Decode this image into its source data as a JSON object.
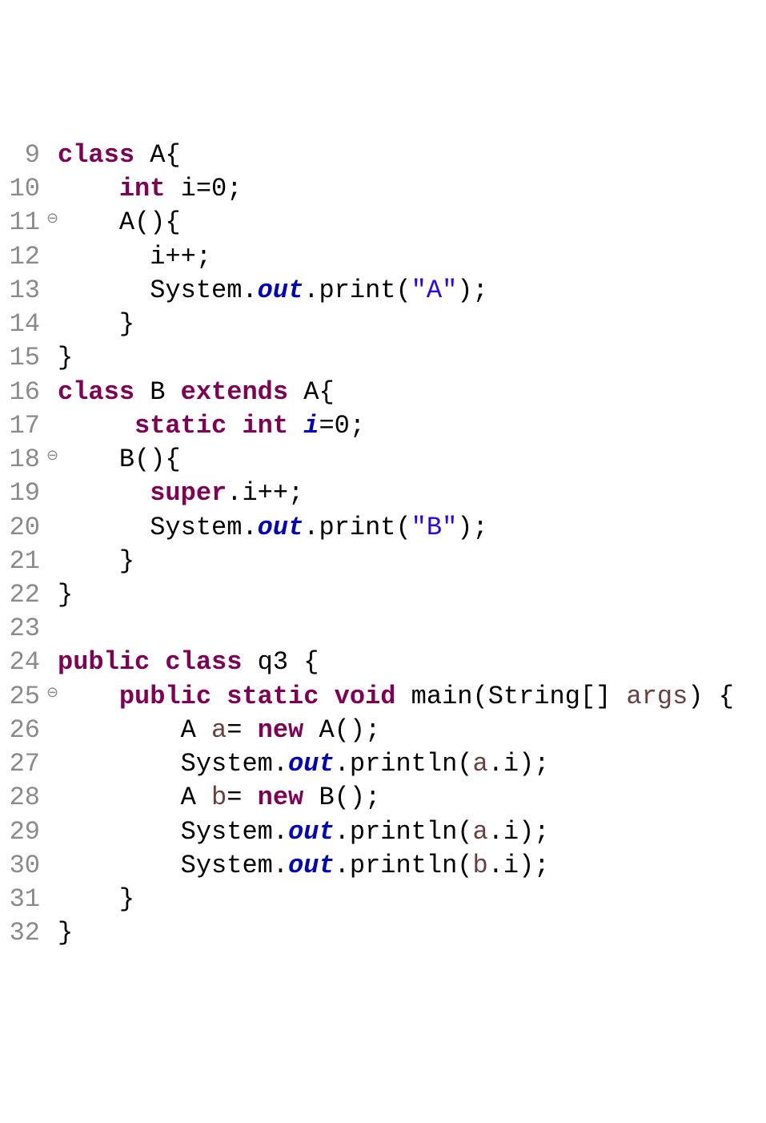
{
  "lines": [
    {
      "num": "9",
      "marker": "",
      "tokens": [
        {
          "t": "class ",
          "c": "kw"
        },
        {
          "t": "A{",
          "c": "plain"
        }
      ]
    },
    {
      "num": "10",
      "marker": "",
      "tokens": [
        {
          "t": "    ",
          "c": "plain"
        },
        {
          "t": "int ",
          "c": "kw"
        },
        {
          "t": "i",
          "c": "plain"
        },
        {
          "t": "=0;",
          "c": "plain"
        }
      ]
    },
    {
      "num": "11",
      "marker": "⊖",
      "tokens": [
        {
          "t": "    A(){",
          "c": "plain"
        }
      ]
    },
    {
      "num": "12",
      "marker": "",
      "tokens": [
        {
          "t": "      i++;",
          "c": "plain"
        }
      ]
    },
    {
      "num": "13",
      "marker": "",
      "tokens": [
        {
          "t": "      System.",
          "c": "plain"
        },
        {
          "t": "out",
          "c": "fld"
        },
        {
          "t": ".print(",
          "c": "plain"
        },
        {
          "t": "\"A\"",
          "c": "str"
        },
        {
          "t": ");",
          "c": "plain"
        }
      ]
    },
    {
      "num": "14",
      "marker": "",
      "tokens": [
        {
          "t": "    }",
          "c": "plain"
        }
      ]
    },
    {
      "num": "15",
      "marker": "",
      "tokens": [
        {
          "t": "}",
          "c": "plain"
        }
      ]
    },
    {
      "num": "16",
      "marker": "",
      "tokens": [
        {
          "t": "class ",
          "c": "kw"
        },
        {
          "t": "B ",
          "c": "plain"
        },
        {
          "t": "extends ",
          "c": "kw"
        },
        {
          "t": "A{",
          "c": "plain"
        }
      ]
    },
    {
      "num": "17",
      "marker": "",
      "tokens": [
        {
          "t": "     ",
          "c": "plain"
        },
        {
          "t": "static int ",
          "c": "kw"
        },
        {
          "t": "i",
          "c": "fld"
        },
        {
          "t": "=0;",
          "c": "plain"
        }
      ]
    },
    {
      "num": "18",
      "marker": "⊖",
      "tokens": [
        {
          "t": "    B(){",
          "c": "plain"
        }
      ]
    },
    {
      "num": "19",
      "marker": "",
      "tokens": [
        {
          "t": "      ",
          "c": "plain"
        },
        {
          "t": "super",
          "c": "kw"
        },
        {
          "t": ".i++;",
          "c": "plain"
        }
      ]
    },
    {
      "num": "20",
      "marker": "",
      "tokens": [
        {
          "t": "      System.",
          "c": "plain"
        },
        {
          "t": "out",
          "c": "fld"
        },
        {
          "t": ".print(",
          "c": "plain"
        },
        {
          "t": "\"B\"",
          "c": "str"
        },
        {
          "t": ");",
          "c": "plain"
        }
      ]
    },
    {
      "num": "21",
      "marker": "",
      "tokens": [
        {
          "t": "    }",
          "c": "plain"
        }
      ]
    },
    {
      "num": "22",
      "marker": "",
      "tokens": [
        {
          "t": "}",
          "c": "plain"
        }
      ]
    },
    {
      "num": "23",
      "marker": "",
      "tokens": []
    },
    {
      "num": "24",
      "marker": "",
      "tokens": [
        {
          "t": "public class ",
          "c": "kw"
        },
        {
          "t": "q3 {",
          "c": "plain"
        }
      ]
    },
    {
      "num": "25",
      "marker": "⊖",
      "tokens": [
        {
          "t": "    ",
          "c": "plain"
        },
        {
          "t": "public static void ",
          "c": "kw"
        },
        {
          "t": "main(String[] ",
          "c": "plain"
        },
        {
          "t": "args",
          "c": "var"
        },
        {
          "t": ") {",
          "c": "plain"
        }
      ]
    },
    {
      "num": "26",
      "marker": "",
      "tokens": [
        {
          "t": "        A ",
          "c": "plain"
        },
        {
          "t": "a",
          "c": "var"
        },
        {
          "t": "= ",
          "c": "plain"
        },
        {
          "t": "new ",
          "c": "kw"
        },
        {
          "t": "A();",
          "c": "plain"
        }
      ]
    },
    {
      "num": "27",
      "marker": "",
      "tokens": [
        {
          "t": "        System.",
          "c": "plain"
        },
        {
          "t": "out",
          "c": "fld"
        },
        {
          "t": ".println(",
          "c": "plain"
        },
        {
          "t": "a",
          "c": "var"
        },
        {
          "t": ".i);",
          "c": "plain"
        }
      ]
    },
    {
      "num": "28",
      "marker": "",
      "tokens": [
        {
          "t": "        A ",
          "c": "plain"
        },
        {
          "t": "b",
          "c": "var"
        },
        {
          "t": "= ",
          "c": "plain"
        },
        {
          "t": "new ",
          "c": "kw"
        },
        {
          "t": "B();",
          "c": "plain"
        }
      ]
    },
    {
      "num": "29",
      "marker": "",
      "tokens": [
        {
          "t": "        System.",
          "c": "plain"
        },
        {
          "t": "out",
          "c": "fld"
        },
        {
          "t": ".println(",
          "c": "plain"
        },
        {
          "t": "a",
          "c": "var"
        },
        {
          "t": ".i);",
          "c": "plain"
        }
      ]
    },
    {
      "num": "30",
      "marker": "",
      "tokens": [
        {
          "t": "        System.",
          "c": "plain"
        },
        {
          "t": "out",
          "c": "fld"
        },
        {
          "t": ".println(",
          "c": "plain"
        },
        {
          "t": "b",
          "c": "var"
        },
        {
          "t": ".i);",
          "c": "plain"
        }
      ]
    },
    {
      "num": "31",
      "marker": "",
      "tokens": [
        {
          "t": "    }",
          "c": "plain"
        }
      ]
    },
    {
      "num": "32",
      "marker": "",
      "tokens": [
        {
          "t": "}",
          "c": "plain"
        }
      ]
    }
  ]
}
